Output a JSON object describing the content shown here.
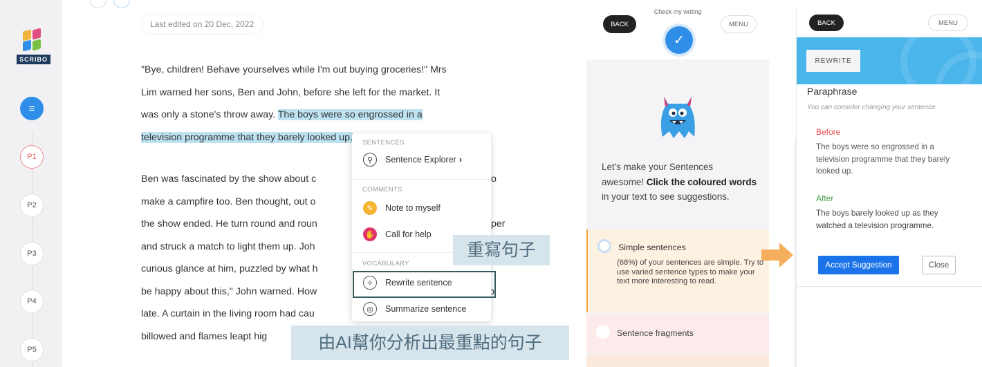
{
  "sidebar": {
    "logo_text": "SCRIBO",
    "steps": [
      {
        "label": "P1"
      },
      {
        "label": "P2"
      },
      {
        "label": "P3"
      },
      {
        "label": "P4"
      },
      {
        "label": "P5"
      }
    ]
  },
  "editor": {
    "last_edited": "Last edited on 20 Dec, 2022",
    "p1_lines": [
      "\"Bye, children! Behave yourselves while I'm out buying groceries!\" Mrs",
      "Lim warned her sons, Ben and John, before she left for the market. It",
      "was only a stone's throw away. "
    ],
    "p1_highlight_a": "The boys were so engrossed in a",
    "p1_highlight_b": "television programme that they barely looked up.",
    "p2_lines": [
      "Ben was fascinated by the show about c",
      "make a campfire too. Ben thought, out o",
      "the show ended. He turn round and roun",
      "and struck a match to light them up. Joh",
      "curious glance at him, puzzled by what h",
      "be happy about this,\" John warned. How",
      "late. A curtain in the living room had cau",
      "billowed and flames leapt hig"
    ],
    "p2_tail": {
      "line0": "o",
      "line2": "per",
      "line5": "o"
    }
  },
  "context_menu": {
    "sentences_header": "SENTENCES",
    "sentence_explorer": "Sentence Explorer",
    "comments_header": "COMMENTS",
    "note_to_myself": "Note to myself",
    "call_for_help": "Call for help",
    "vocabulary_header": "VOCABULARY",
    "rewrite_sentence": "Rewrite sentence",
    "summarize_sentence": "Summarize sentence"
  },
  "annotations": {
    "rewrite": "重寫句子",
    "ai": "由AI幫你分析出最重點的句子"
  },
  "suggestions_panel": {
    "back": "BACK",
    "menu": "MENU",
    "check_label": "Check my writing",
    "prompt_a": "Let's make your Sentences awesome! ",
    "prompt_bold": "Click the coloured words",
    "prompt_b": " in your text to see suggestions.",
    "simple_title": "Simple sentences",
    "simple_body": "(68%) of your sentences are simple. Try to use varied sentence types to make your text more interesting to read.",
    "fragments_title": "Sentence fragments"
  },
  "rewrite_panel": {
    "back": "BACK",
    "menu": "MENU",
    "tab": "REWRITE",
    "heading": "Paraphrase",
    "subheading": "You can consider changing your sentence.",
    "before_label": "Before",
    "before_text": "The boys were so engrossed in a television programme that they barely looked up.",
    "after_label": "After",
    "after_text": "The boys barely looked up as they watched a television programme.",
    "accept": "Accept Suggestion",
    "close": "Close"
  },
  "colors": {
    "accent_blue": "#2f8fe8",
    "highlight": "#bde3f3",
    "rewrite_band": "#49b5eb",
    "accept_button": "#1a73e8",
    "before_red": "#e34b4b",
    "after_green": "#4aa54a",
    "arrow_orange": "#f5ae5b"
  }
}
